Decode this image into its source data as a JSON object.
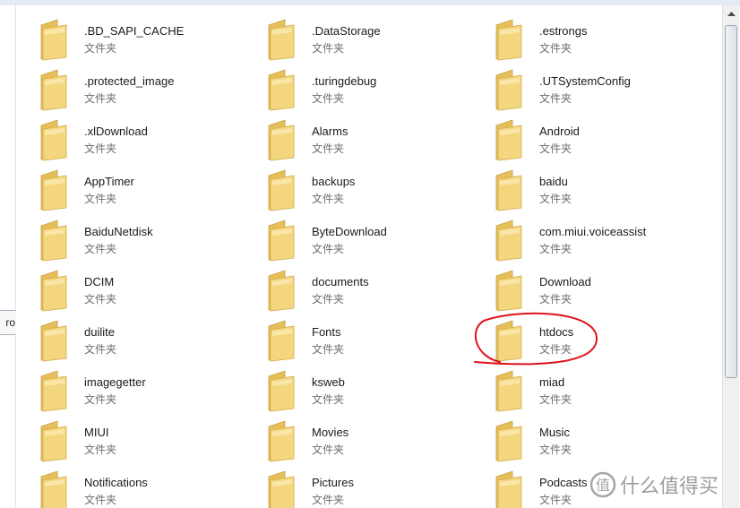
{
  "left_pane": {
    "partial_label": "ro"
  },
  "folder_type_label": "文件夹",
  "folders": [
    {
      "name": ".BD_SAPI_CACHE",
      "type": "文件夹"
    },
    {
      "name": ".DataStorage",
      "type": "文件夹"
    },
    {
      "name": ".estrongs",
      "type": "文件夹"
    },
    {
      "name": ".protected_image",
      "type": "文件夹"
    },
    {
      "name": ".turingdebug",
      "type": "文件夹"
    },
    {
      "name": ".UTSystemConfig",
      "type": "文件夹"
    },
    {
      "name": ".xlDownload",
      "type": "文件夹"
    },
    {
      "name": "Alarms",
      "type": "文件夹"
    },
    {
      "name": "Android",
      "type": "文件夹"
    },
    {
      "name": "AppTimer",
      "type": "文件夹"
    },
    {
      "name": "backups",
      "type": "文件夹"
    },
    {
      "name": "baidu",
      "type": "文件夹"
    },
    {
      "name": "BaiduNetdisk",
      "type": "文件夹"
    },
    {
      "name": "ByteDownload",
      "type": "文件夹"
    },
    {
      "name": "com.miui.voiceassist",
      "type": "文件夹"
    },
    {
      "name": "DCIM",
      "type": "文件夹"
    },
    {
      "name": "documents",
      "type": "文件夹"
    },
    {
      "name": "Download",
      "type": "文件夹"
    },
    {
      "name": "duilite",
      "type": "文件夹"
    },
    {
      "name": "Fonts",
      "type": "文件夹"
    },
    {
      "name": "htdocs",
      "type": "文件夹",
      "highlighted": true
    },
    {
      "name": "imagegetter",
      "type": "文件夹"
    },
    {
      "name": "ksweb",
      "type": "文件夹"
    },
    {
      "name": "miad",
      "type": "文件夹"
    },
    {
      "name": "MIUI",
      "type": "文件夹"
    },
    {
      "name": "Movies",
      "type": "文件夹"
    },
    {
      "name": "Music",
      "type": "文件夹"
    },
    {
      "name": "Notifications",
      "type": "文件夹"
    },
    {
      "name": "Pictures",
      "type": "文件夹"
    },
    {
      "name": "Podcasts",
      "type": "文件夹"
    }
  ],
  "watermark": {
    "text": "什么值得买",
    "icon": "value-badge-icon"
  },
  "colors": {
    "folder_front": "#f3d67e",
    "folder_back": "#e6bf5a",
    "annotation_red": "#e0121b"
  }
}
